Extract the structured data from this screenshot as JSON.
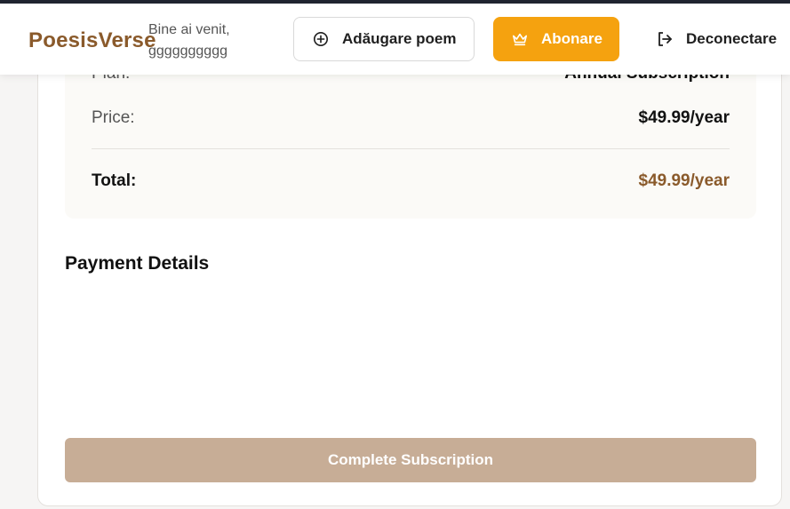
{
  "header": {
    "brand": "PoesisVerse",
    "welcome_line1": "Bine ai venit,",
    "welcome_line2": "gggggggggg",
    "add_poem_label": "Adăugare poem",
    "subscribe_label": "Abonare",
    "logout_label": "Deconectare"
  },
  "summary": {
    "plan_label": "Plan:",
    "plan_value": "Annual Subscription",
    "price_label": "Price:",
    "price_value": "$49.99/year",
    "total_label": "Total:",
    "total_value": "$49.99/year"
  },
  "payment": {
    "title": "Payment Details",
    "complete_label": "Complete Subscription"
  },
  "colors": {
    "brand": "#8a5a2b",
    "accent": "#f5a20f",
    "disabled_button": "#c7ad96"
  },
  "icons": {
    "add": "plus-circle-icon",
    "subscribe": "crown-icon",
    "logout": "logout-icon"
  }
}
